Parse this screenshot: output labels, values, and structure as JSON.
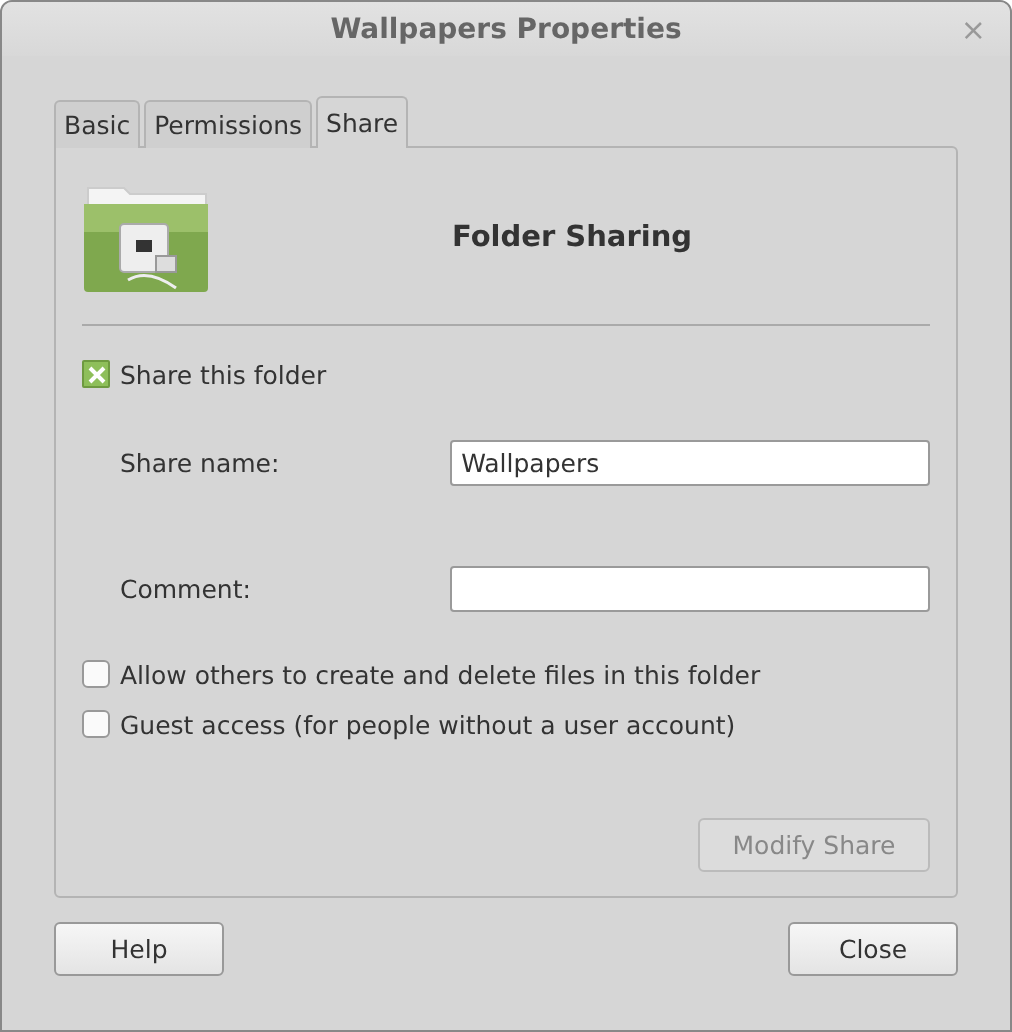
{
  "window": {
    "title": "Wallpapers Properties",
    "close": "×"
  },
  "tabs": [
    {
      "label": "Basic",
      "selected": false
    },
    {
      "label": "Permissions",
      "selected": false
    },
    {
      "label": "Share",
      "selected": true
    }
  ],
  "heading": "Folder Sharing",
  "share_folder": {
    "label": "Share this folder",
    "checked": true
  },
  "fields": [
    {
      "label": "Share name:",
      "value": "Wallpapers"
    },
    {
      "label": "Comment:"
    }
  ],
  "options": [
    {
      "label": "Allow others to create and delete files in this folder",
      "checked": false
    },
    {
      "label": "Guest access (for people without a user account)",
      "checked": false
    }
  ],
  "modify_button": {
    "label": "Modify Share",
    "disabled": true
  },
  "buttons": [
    "Help",
    "Close"
  ]
}
